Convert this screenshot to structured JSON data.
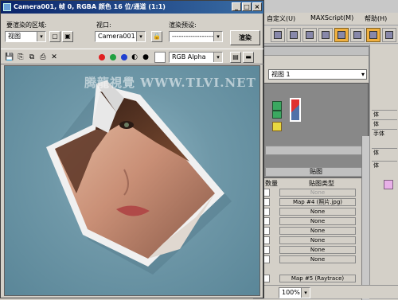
{
  "background_app": {
    "menu": [
      "帮助(H)",
      "自定义(U)",
      "MAXScript(M)",
      "帮助(H)"
    ],
    "viewport_label": "视图 1",
    "material_dropdown": "视图 1",
    "rollout_map": "贴图",
    "col_amount": "数量",
    "col_map_type": "贴图类型",
    "map_rows": [
      {
        "spin": "100",
        "label": "None",
        "dim": true
      },
      {
        "spin": "100",
        "label": "Map #4 (照片.jpg)",
        "dim": false
      },
      {
        "spin": "100",
        "label": "None",
        "dim": false
      },
      {
        "spin": "100",
        "label": "None",
        "dim": false
      },
      {
        "spin": "100",
        "label": "None",
        "dim": false
      },
      {
        "spin": "100",
        "label": "None",
        "dim": false
      },
      {
        "spin": "100",
        "label": "None",
        "dim": false
      },
      {
        "spin": "100",
        "label": "None",
        "dim": false
      },
      {
        "spin": "100",
        "label": "Map #5 (Raytrace)",
        "dim": false
      }
    ],
    "zoom": "100%",
    "strip_items": [
      "体",
      "体",
      "手体",
      "体",
      "体"
    ],
    "colors": {
      "swatch_red": "#e03030",
      "swatch_green": "#3aa860",
      "swatch_yellow": "#e8d840",
      "swatch_blue": "#5070a8"
    }
  },
  "render_window": {
    "title": "Camera001, 帧 0, RGBA 颜色 16 位/通道 (1:1)",
    "area_label": "要渲染的区域:",
    "area_value": "视图",
    "viewport_label": "视口:",
    "viewport_value": "Camera001",
    "preset_label": "渲染预设:",
    "preset_value": "-------------------",
    "render_button": "渲染",
    "channel_value": "RGB Alpha",
    "watermark": "腾龍視覺 WWW.TLVI.NET",
    "colors": {
      "red": "#e02020",
      "green": "#20a040",
      "blue": "#2040d0"
    }
  }
}
